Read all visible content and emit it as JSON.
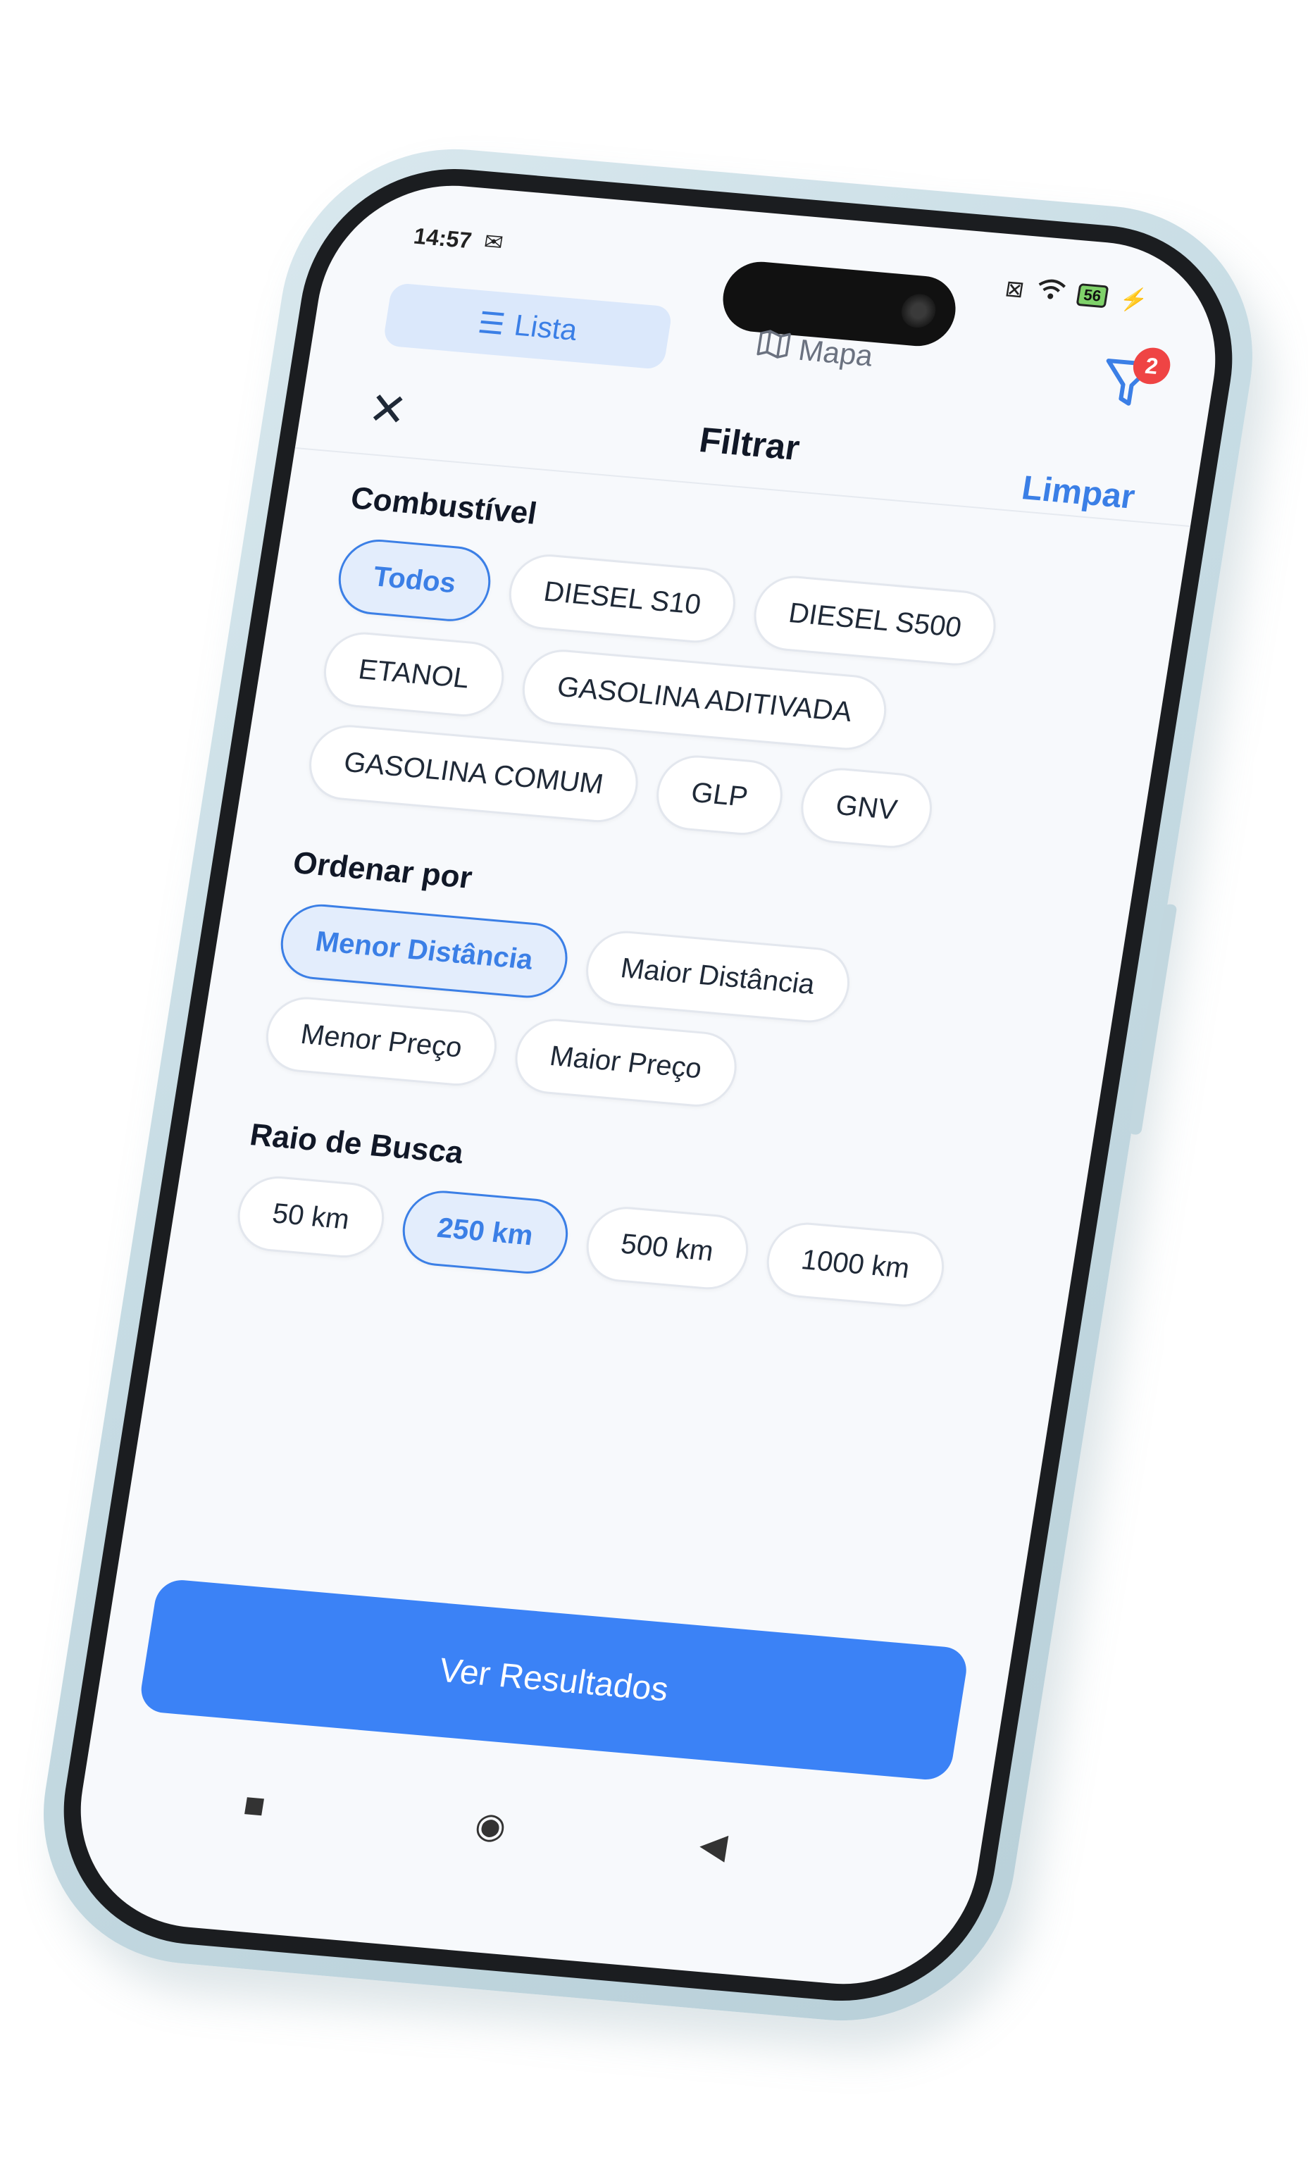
{
  "status": {
    "time": "14:57",
    "gmail_icon": "gmail-icon",
    "battery": "56"
  },
  "tabs": [
    {
      "label": "Lista",
      "icon": "list-icon"
    },
    {
      "label": "Mapa",
      "icon": "map-icon"
    }
  ],
  "filter_badge": "2",
  "header": {
    "title": "Filtrar",
    "clear_label": "Limpar"
  },
  "sections": {
    "fuel": {
      "title": "Combustível",
      "options": [
        "Todos",
        "DIESEL S10",
        "DIESEL S500",
        "ETANOL",
        "GASOLINA ADITIVADA",
        "GASOLINA COMUM",
        "GLP",
        "GNV"
      ],
      "selected": "Todos"
    },
    "sort": {
      "title": "Ordenar por",
      "options": [
        "Menor Distância",
        "Maior Distância",
        "Menor Preço",
        "Maior Preço"
      ],
      "selected": "Menor Distância"
    },
    "radius": {
      "title": "Raio de Busca",
      "options": [
        "50 km",
        "250 km",
        "500 km",
        "1000 km"
      ],
      "selected": "250 km"
    }
  },
  "results_button": "Ver Resultados",
  "colors": {
    "accent": "#3b7fe6",
    "button": "#3b82f6",
    "badge": "#ef4444"
  }
}
